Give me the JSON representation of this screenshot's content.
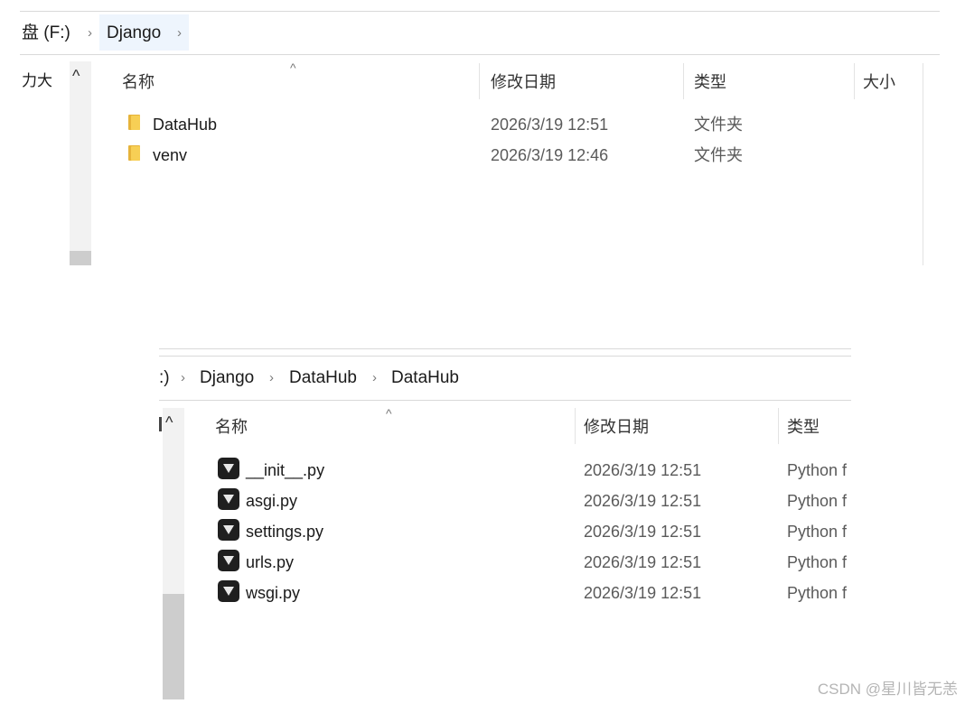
{
  "window1": {
    "breadcrumb": [
      "盘 (F:)",
      "Django"
    ],
    "sidebar_partial_text": "力大",
    "columns": [
      "名称",
      "修改日期",
      "类型",
      "大小"
    ],
    "rows": [
      {
        "name": "DataHub",
        "date": "2026/3/19 12:51",
        "type": "文件夹",
        "icon": "folder-icon"
      },
      {
        "name": "venv",
        "date": "2026/3/19 12:46",
        "type": "文件夹",
        "icon": "folder-icon"
      }
    ]
  },
  "window2": {
    "breadcrumb": [
      ":)",
      "Django",
      "DataHub",
      "DataHub"
    ],
    "sidebar_partial_text": "",
    "columns": [
      "名称",
      "修改日期",
      "类型"
    ],
    "rows": [
      {
        "name": "__init__.py",
        "date": "2026/3/19 12:51",
        "type": "Python f",
        "icon": "python-file-icon"
      },
      {
        "name": "asgi.py",
        "date": "2026/3/19 12:51",
        "type": "Python f",
        "icon": "python-file-icon"
      },
      {
        "name": "settings.py",
        "date": "2026/3/19 12:51",
        "type": "Python f",
        "icon": "python-file-icon"
      },
      {
        "name": "urls.py",
        "date": "2026/3/19 12:51",
        "type": "Python f",
        "icon": "python-file-icon"
      },
      {
        "name": "wsgi.py",
        "date": "2026/3/19 12:51",
        "type": "Python f",
        "icon": "python-file-icon"
      }
    ]
  },
  "watermark": "CSDN @星川皆无恙"
}
